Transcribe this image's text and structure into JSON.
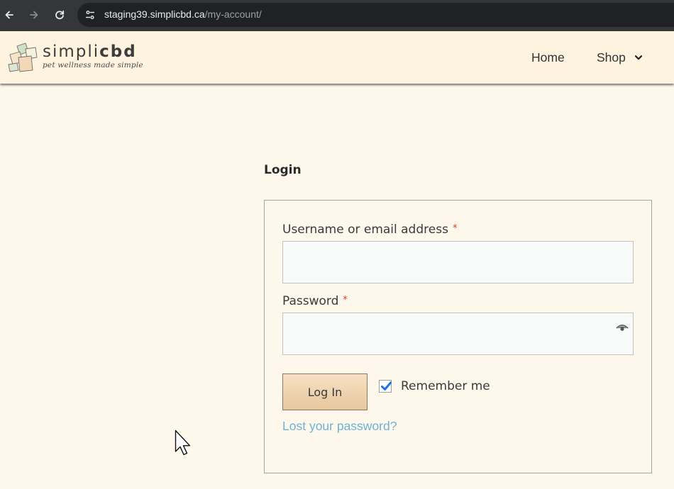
{
  "browser": {
    "url_host": "staging39.simplicbd.ca",
    "url_path": "/my-account/",
    "icons": [
      "back-arrow-icon",
      "forward-arrow-icon",
      "reload-icon",
      "site-info-icon"
    ]
  },
  "header": {
    "brand_part1": "simpli",
    "brand_part2": "cbd",
    "tagline": "pet wellness made simple",
    "nav": {
      "home": "Home",
      "shop": "Shop"
    }
  },
  "login": {
    "heading": "Login",
    "username_label": "Username or email address",
    "password_label": "Password",
    "required_mark": "*",
    "username_value": "",
    "password_value": "",
    "submit_label": "Log In",
    "remember_label": "Remember me",
    "remember_checked": true,
    "lost_password": "Lost your password?"
  },
  "colors": {
    "page_bg": "#fef8ec",
    "header_bg": "#fdf3df",
    "link": "#6bb3d6",
    "required": "#e2401c",
    "button_gradient_top": "#f6e1c5",
    "button_gradient_bottom": "#e8c79c",
    "checkbox_check": "#1a73e8"
  }
}
